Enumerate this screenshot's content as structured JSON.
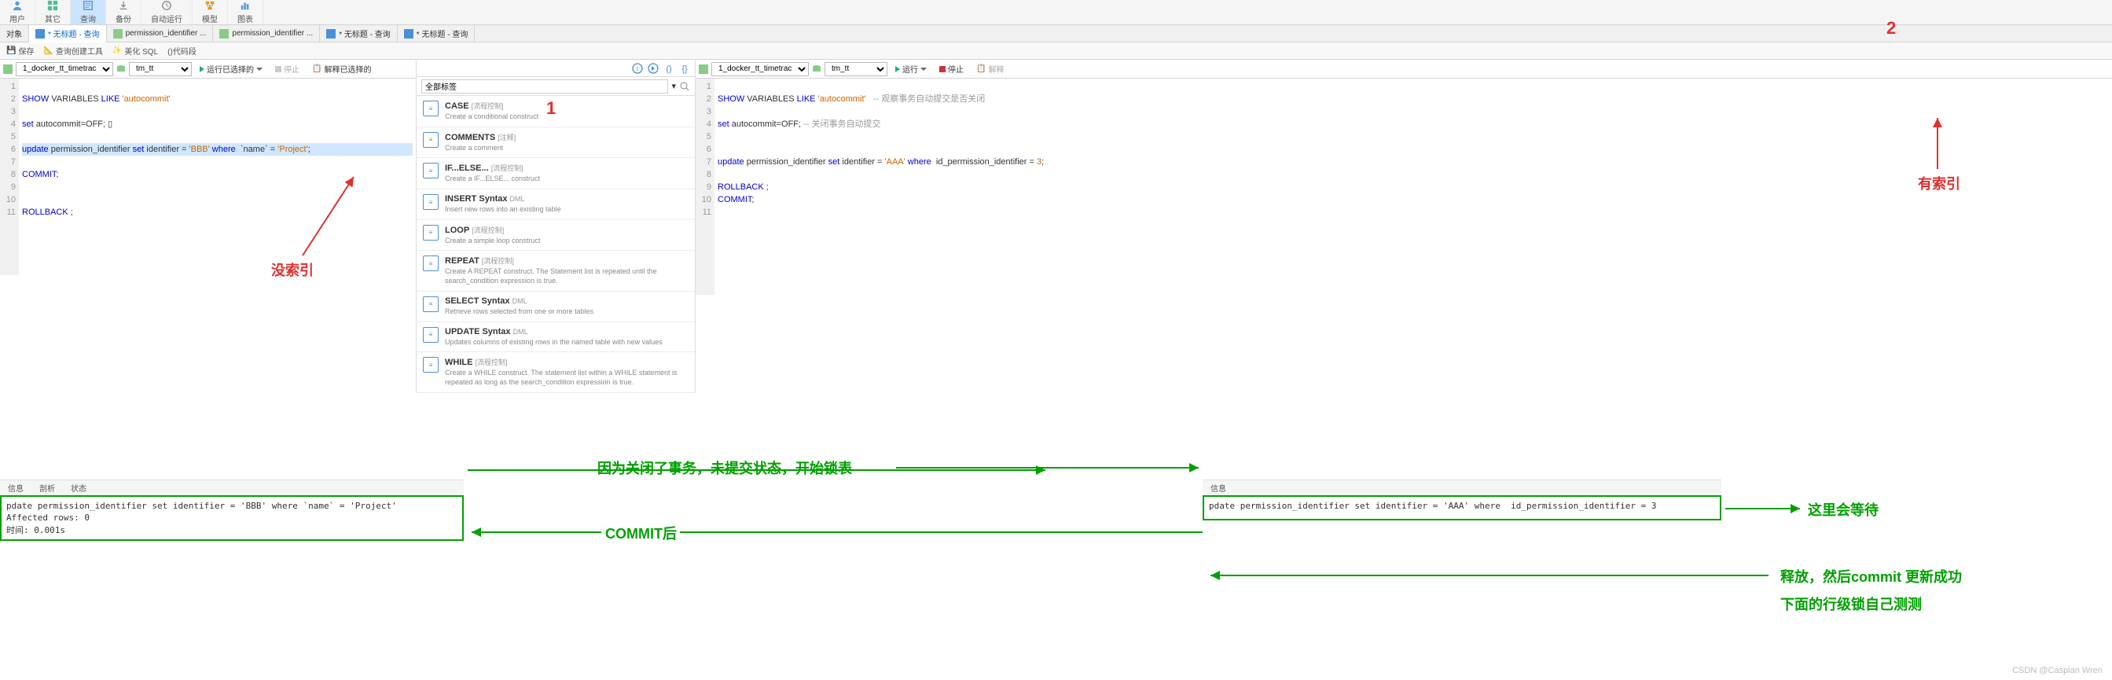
{
  "ribbon": {
    "items": [
      "用户",
      "其它",
      "查询",
      "备份",
      "自动运行",
      "模型",
      "图表"
    ],
    "active_index": 2
  },
  "tabs": {
    "items": [
      {
        "label": "对象"
      },
      {
        "label": "* 无标题 - 查询",
        "active": true
      },
      {
        "label": "permission_identifier ..."
      },
      {
        "label": "permission_identifier ..."
      },
      {
        "label": "* 无标题 - 查询"
      },
      {
        "label": "* 无标题 - 查询"
      }
    ]
  },
  "subbar": {
    "save": "保存",
    "query_builder": "查询创建工具",
    "beautify": "美化 SQL",
    "snippet": "()代码段"
  },
  "connection_left": {
    "conn": "1_docker_tt_timetrac",
    "db": "tm_tt",
    "run": "运行已选择的",
    "stop": "停止",
    "explain": "解释已选择的"
  },
  "connection_right": {
    "conn": "1_docker_tt_timetrac",
    "db": "tm_tt",
    "run": "运行",
    "stop": "停止",
    "explain": "解释"
  },
  "editor_left": {
    "lines": [
      {
        "n": 1,
        "html": ""
      },
      {
        "n": 2,
        "html": "<span class='kw'>SHOW</span> VARIABLES <span class='kw'>LIKE</span> <span class='str'>'autocommit'</span>"
      },
      {
        "n": 3,
        "html": ""
      },
      {
        "n": 4,
        "html": "<span class='kw'>set</span> autocommit=OFF; ▯"
      },
      {
        "n": 5,
        "html": ""
      },
      {
        "n": 6,
        "html": "<span class='hl'><span class='kw'>update</span> permission_identifier <span class='kw'>set</span> identifier = <span class='str'>'BBB'</span> <span class='kw'>where</span>  `name` = <span class='str'>'Project'</span>;</span>"
      },
      {
        "n": 7,
        "html": ""
      },
      {
        "n": 8,
        "html": "<span class='kw'>COMMIT</span>;"
      },
      {
        "n": 9,
        "html": ""
      },
      {
        "n": 10,
        "html": ""
      },
      {
        "n": 11,
        "html": "<span class='kw'>ROLLBACK</span> ;"
      }
    ]
  },
  "editor_right": {
    "lines": [
      {
        "n": 1,
        "html": ""
      },
      {
        "n": 2,
        "html": "<span class='kw'>SHOW</span> VARIABLES <span class='kw'>LIKE</span> <span class='str'>'autocommit'</span>   <span class='cmt'>-- 观察事务自动提交是否关闭</span>"
      },
      {
        "n": 3,
        "html": ""
      },
      {
        "n": 4,
        "html": "<span class='kw'>set</span> autocommit=OFF; <span class='cmt'>-- 关闭事务自动提交</span>"
      },
      {
        "n": 5,
        "html": ""
      },
      {
        "n": 6,
        "html": ""
      },
      {
        "n": 7,
        "html": "<span class='kw'>update</span> permission_identifier <span class='kw'>set</span> identifier = <span class='str'>'AAA'</span> <span class='kw'>where</span>  id_permission_identifier = <span class='str'>3</span>;"
      },
      {
        "n": 8,
        "html": ""
      },
      {
        "n": 9,
        "html": "<span class='kw'>ROLLBACK</span> ;"
      },
      {
        "n": 10,
        "html": "<span class='kw'>COMMIT</span>;"
      },
      {
        "n": 11,
        "html": ""
      }
    ]
  },
  "snippets": {
    "header": "全部标签",
    "items": [
      {
        "title": "CASE",
        "tag": "[流程控制]",
        "desc": "Create a conditional construct"
      },
      {
        "title": "COMMENTS",
        "tag": "[注释]",
        "desc": "Create a comment"
      },
      {
        "title": "IF...ELSE...",
        "tag": "[流程控制]",
        "desc": "Create a IF...ELSE... construct"
      },
      {
        "title": "INSERT Syntax",
        "tag": "DML",
        "desc": "Insert new rows into an existing table"
      },
      {
        "title": "LOOP",
        "tag": "[流程控制]",
        "desc": "Create a simple loop construct"
      },
      {
        "title": "REPEAT",
        "tag": "[流程控制]",
        "desc": "Create A REPEAT construct. The Statement list is repeated until the search_condition expression is true."
      },
      {
        "title": "SELECT Syntax",
        "tag": "DML",
        "desc": "Retrieve rows selected from one or more tables"
      },
      {
        "title": "UPDATE Syntax",
        "tag": "DML",
        "desc": "Updates columns of existing rows in the named table with new values"
      },
      {
        "title": "WHILE",
        "tag": "[流程控制]",
        "desc": "Create a WHILE construct. The statement list within a WHILE statement is repeated as long as the search_condition expression is true."
      }
    ]
  },
  "output_left": {
    "tabs": [
      "信息",
      "剖析",
      "状态"
    ],
    "body": "pdate permission_identifier set identifier = 'BBB' where `name` = 'Project'\nAffected rows: 0\n时间: 0.001s"
  },
  "output_right": {
    "tabs": [
      "信息"
    ],
    "body": "pdate permission_identifier set identifier = 'AAA' where  id_permission_identifier = 3"
  },
  "annotations": {
    "num1": "1",
    "num2": "2",
    "no_index": "没索引",
    "has_index": "有索引",
    "lock_msg": "因为关闭了事务，未提交状态，开始锁表",
    "commit_after": "COMMIT后",
    "wait_msg": "这里会等待",
    "release_msg": "释放，然后commit 更新成功",
    "row_lock_msg": "下面的行级锁自己测测",
    "watermark": "CSDN @Caspian Wren"
  }
}
